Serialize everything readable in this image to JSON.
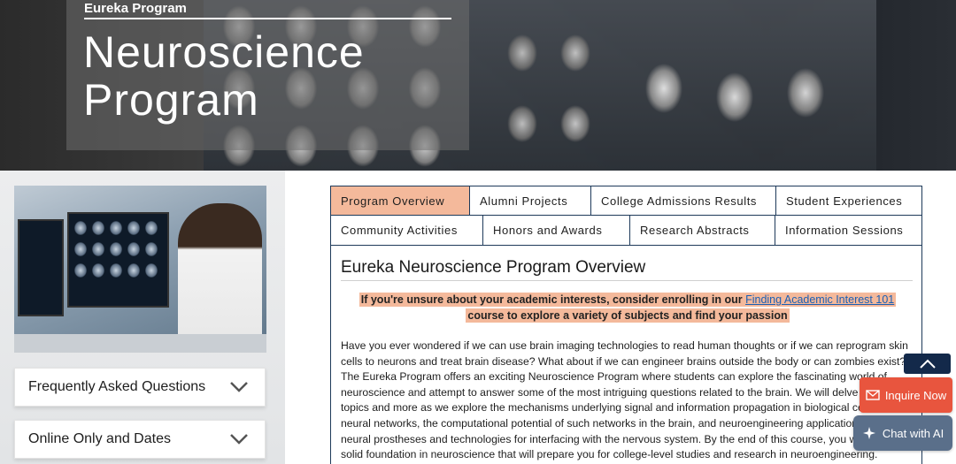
{
  "hero": {
    "eyebrow": "Eureka Program",
    "title": "Neuroscience Program"
  },
  "sidebar": {
    "accordions": [
      {
        "label": "Frequently Asked Questions"
      },
      {
        "label": "Online Only and Dates"
      }
    ]
  },
  "tabs": {
    "row1": [
      "Program Overview",
      "Alumni Projects",
      "College Admissions Results",
      "Student Experiences"
    ],
    "row2": [
      "Community Activities",
      "Honors and Awards",
      "Research Abstracts",
      "Information Sessions"
    ],
    "active": "Program Overview"
  },
  "content": {
    "title": "Eureka Neuroscience Program Overview",
    "callout_before": "If you're unsure about your academic interests, consider enrolling in our ",
    "callout_link": "Finding Academic Interest 101",
    "callout_after": " course to explore a variety of subjects and find your passion",
    "body": "Have you ever wondered if we can use brain imaging technologies to read human thoughts or if we can reprogram skin cells to neurons and treat brain disease? What about if we can engineer brains outside the body or can zombies exist? The Eureka Program offers an exciting Neuroscience Program where students can explore the fascinating world of neuroscience and attempt to answer some of the most intriguing questions related to the brain. We will delve into these topics and more as we explore the mechanisms underlying signal and information propagation in biological cellular neural networks, the computational potential of such networks in the brain, and neuroengineering applications such as neural prostheses and technologies for interfacing with the nervous system. By the end of this course, you will have a solid foundation in neuroscience that will prepare you for college-level studies and research in neuroengineering."
  },
  "floating": {
    "inquire_label": "Inquire Now",
    "chat_label": "Chat with AI"
  },
  "colors": {
    "accent": "#f4b99b",
    "navy": "#1e3a5a",
    "inquire": "#e8553e",
    "chat": "#5a6f8a"
  }
}
